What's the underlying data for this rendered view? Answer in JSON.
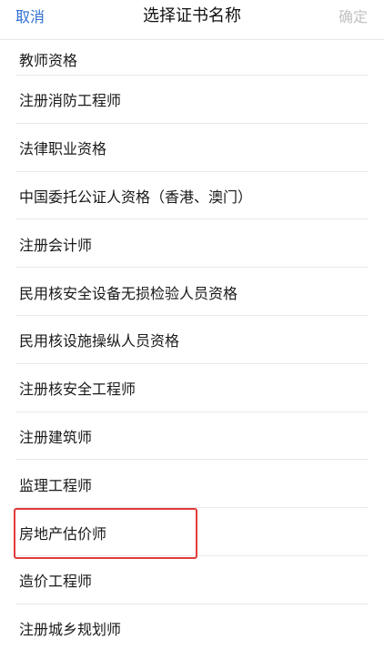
{
  "header": {
    "cancel_label": "取消",
    "title": "选择证书名称",
    "confirm_label": "确定"
  },
  "certificates": [
    "教师资格",
    "注册消防工程师",
    "法律职业资格",
    "中国委托公证人资格（香港、澳门）",
    "注册会计师",
    "民用核安全设备无损检验人员资格",
    "民用核设施操纵人员资格",
    "注册核安全工程师",
    "注册建筑师",
    "监理工程师",
    "房地产估价师",
    "造价工程师",
    "注册城乡规划师"
  ],
  "highlighted_item": "房地产估价师",
  "colors": {
    "accent": "#2f6fd3",
    "disabled": "#c2c2c2",
    "highlight_border": "#e23b3b"
  }
}
